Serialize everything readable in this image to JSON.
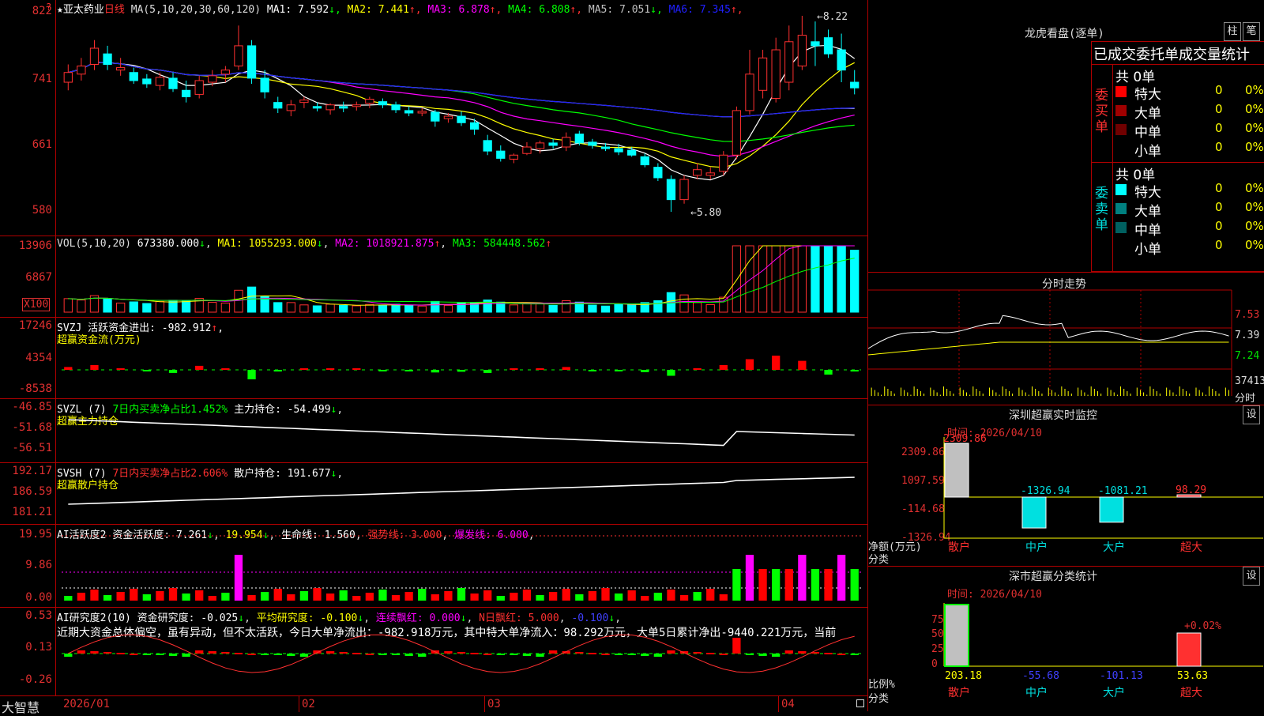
{
  "main": {
    "stock_name": "亚太药业",
    "period": "日线",
    "ma_params": "MA(5,10,20,30,60,120)",
    "ma": [
      {
        "label": "MA1: 7.592",
        "arrow": "↓",
        "color": "#ffffff"
      },
      {
        "label": "MA2: 7.441",
        "arrow": "↑",
        "color": "#ffff00"
      },
      {
        "label": "MA3: 6.878",
        "arrow": "↑",
        "color": "#ff00ff"
      },
      {
        "label": "MA4: 6.808",
        "arrow": "↑",
        "color": "#00ff00"
      },
      {
        "label": "MA5: 7.051",
        "arrow": "↓",
        "color": "#c0c0c0"
      },
      {
        "label": "MA6: 7.345",
        "arrow": "↑",
        "color": "#2020ff"
      }
    ],
    "y_ticks": [
      "822",
      "741",
      "661",
      "580"
    ],
    "high_mark": "8.22",
    "low_mark": "5.80"
  },
  "vol": {
    "header": "VOL(5,10,20)",
    "value": "673380.000",
    "ma1": "MA1: 1055293.000",
    "ma2": "MA2: 1018921.875",
    "ma3": "MA3: 584448.562",
    "y_ticks": [
      "13906",
      "6867"
    ],
    "unit": "X100"
  },
  "svzj": {
    "name": "SVZJ",
    "label": "活跃资金进出: -982.912",
    "subtitle": "超赢资金流(万元)",
    "y_ticks": [
      "17246",
      "4354",
      "-8538"
    ]
  },
  "svzl": {
    "name": "SVZL  (7)",
    "text1": "7日内买卖净占比1.452%",
    "text2": "主力持仓: -54.499",
    "subtitle": "超赢主力持仓",
    "y_ticks": [
      "-46.85",
      "-51.68",
      "-56.51"
    ]
  },
  "svsh": {
    "name": "SVSH  (7)",
    "text1": "7日内买卖净占比2.606%",
    "text2": "散户持仓: 191.677",
    "subtitle": "超赢散户持仓",
    "y_ticks": [
      "192.17",
      "186.59",
      "181.21"
    ]
  },
  "ai1": {
    "name": "AI活跃度2",
    "t1": "资金活跃度: 7.261",
    "t2": "19.954",
    "t3": "生命线: 1.560",
    "t4": "强势线: 3.000",
    "t5": "爆发线: 6.000",
    "y_ticks": [
      "19.95",
      "9.86",
      "0.00"
    ]
  },
  "ai2": {
    "name": "AI研究度2(10)",
    "t1": "资金研究度: -0.025",
    "t2": "平均研究度: -0.100",
    "t3": "连续飘红: 0.000",
    "t4": "N日飘红: 5.000",
    "t5": "-0.100",
    "comment": "近期大资金总体偏空，虽有异动，但不太活跃，今日大单净流出：-982.918万元，其中特大单净流入：98.292万元，大单5日累计净出-9440.221万元，当前",
    "y_ticks": [
      "0.53",
      "0.13",
      "-0.26"
    ]
  },
  "bottom": {
    "brand": "大智慧",
    "dates": [
      "2026/01",
      "02",
      "03",
      "04"
    ]
  },
  "right": {
    "title": "龙虎看盘(逐单)",
    "tabs": [
      "柱",
      "笔"
    ],
    "header": "已成交委托单成交量统计",
    "buy_label": "委买单",
    "sell_label": "委卖单",
    "buy_total": "共 0单",
    "sell_total": "共 0单",
    "buy_rows": [
      {
        "name": "特大",
        "count": "0",
        "pct": "0%",
        "color": "#ff0000"
      },
      {
        "name": "大单",
        "count": "0",
        "pct": "0%",
        "color": "#a00000"
      },
      {
        "name": "中单",
        "count": "0",
        "pct": "0%",
        "color": "#700000"
      },
      {
        "name": "小单",
        "count": "0",
        "pct": "0%",
        "color": ""
      }
    ],
    "sell_rows": [
      {
        "name": "特大",
        "count": "0",
        "pct": "0%",
        "color": "#00ffff"
      },
      {
        "name": "大单",
        "count": "0",
        "pct": "0%",
        "color": "#008080"
      },
      {
        "name": "中单",
        "count": "0",
        "pct": "0%",
        "color": "#006060"
      },
      {
        "name": "小单",
        "count": "0",
        "pct": "0%",
        "color": ""
      }
    ],
    "intraday_title": "分时走势",
    "intraday_ticks": [
      "7.53",
      "7.39",
      "7.24"
    ],
    "intraday_vol": "37413",
    "intraday_label": "分时",
    "monitor_title": "深圳超赢实时监控",
    "monitor_settings": "设",
    "monitor_time": "时间: 2026/04/10",
    "monitor_y": [
      "2309.86",
      "1097.59",
      "-114.68",
      "-1326.94"
    ],
    "monitor_values": [
      "2309.86",
      "-1326.94",
      "-1081.21",
      "98.29"
    ],
    "monitor_axis_label": "净额(万元)",
    "monitor_axis_label2": "分类",
    "categories": [
      "散户",
      "中户",
      "大户",
      "超大"
    ],
    "stats_title": "深市超赢分类统计",
    "stats_settings": "设",
    "stats_time": "时间: 2026/04/10",
    "stats_y": [
      "75",
      "50",
      "25",
      "0"
    ],
    "stats_values": [
      "203.18",
      "-55.68",
      "-101.13",
      "53.63"
    ],
    "stats_pct": "+0.02%",
    "stats_axis_label": "比例%",
    "stats_axis_label2": "分类"
  },
  "chart_data": {
    "type": "candlestick",
    "x_labels": [
      "2026/01",
      "02",
      "03",
      "04"
    ],
    "ylim": [
      5.8,
      8.22
    ],
    "ohlc": [
      {
        "o": 7.4,
        "h": 7.62,
        "l": 7.3,
        "c": 7.52
      },
      {
        "o": 7.5,
        "h": 7.7,
        "l": 7.42,
        "c": 7.6
      },
      {
        "o": 7.62,
        "h": 7.92,
        "l": 7.55,
        "c": 7.82
      },
      {
        "o": 7.75,
        "h": 7.85,
        "l": 7.55,
        "c": 7.62
      },
      {
        "o": 7.55,
        "h": 7.7,
        "l": 7.48,
        "c": 7.58
      },
      {
        "o": 7.52,
        "h": 7.58,
        "l": 7.38,
        "c": 7.42
      },
      {
        "o": 7.44,
        "h": 7.5,
        "l": 7.33,
        "c": 7.38
      },
      {
        "o": 7.36,
        "h": 7.52,
        "l": 7.3,
        "c": 7.46
      },
      {
        "o": 7.45,
        "h": 7.52,
        "l": 7.28,
        "c": 7.32
      },
      {
        "o": 7.3,
        "h": 7.42,
        "l": 7.15,
        "c": 7.22
      },
      {
        "o": 7.25,
        "h": 7.48,
        "l": 7.2,
        "c": 7.42
      },
      {
        "o": 7.4,
        "h": 7.55,
        "l": 7.35,
        "c": 7.48
      },
      {
        "o": 7.5,
        "h": 7.6,
        "l": 7.4,
        "c": 7.55
      },
      {
        "o": 7.6,
        "h": 8.1,
        "l": 7.55,
        "c": 7.85
      },
      {
        "o": 7.85,
        "h": 7.92,
        "l": 7.38,
        "c": 7.45
      },
      {
        "o": 7.45,
        "h": 7.55,
        "l": 7.2,
        "c": 7.28
      },
      {
        "o": 7.15,
        "h": 7.22,
        "l": 7.02,
        "c": 7.08
      },
      {
        "o": 7.05,
        "h": 7.18,
        "l": 6.98,
        "c": 7.12
      },
      {
        "o": 7.15,
        "h": 7.22,
        "l": 7.08,
        "c": 7.18
      },
      {
        "o": 7.1,
        "h": 7.15,
        "l": 7.04,
        "c": 7.08
      },
      {
        "o": 7.06,
        "h": 7.14,
        "l": 7.0,
        "c": 7.12
      },
      {
        "o": 7.1,
        "h": 7.16,
        "l": 7.03,
        "c": 7.08
      },
      {
        "o": 7.1,
        "h": 7.16,
        "l": 7.05,
        "c": 7.12
      },
      {
        "o": 7.14,
        "h": 7.22,
        "l": 7.08,
        "c": 7.19
      },
      {
        "o": 7.16,
        "h": 7.2,
        "l": 7.08,
        "c": 7.12
      },
      {
        "o": 7.12,
        "h": 7.16,
        "l": 7.02,
        "c": 7.06
      },
      {
        "o": 7.05,
        "h": 7.1,
        "l": 6.98,
        "c": 7.02
      },
      {
        "o": 7.02,
        "h": 7.08,
        "l": 6.98,
        "c": 7.04
      },
      {
        "o": 7.03,
        "h": 7.06,
        "l": 6.85,
        "c": 6.92
      },
      {
        "o": 6.95,
        "h": 7.02,
        "l": 6.9,
        "c": 6.98
      },
      {
        "o": 6.98,
        "h": 7.04,
        "l": 6.86,
        "c": 6.9
      },
      {
        "o": 6.9,
        "h": 6.95,
        "l": 6.75,
        "c": 6.82
      },
      {
        "o": 6.68,
        "h": 6.75,
        "l": 6.5,
        "c": 6.55
      },
      {
        "o": 6.55,
        "h": 6.62,
        "l": 6.42,
        "c": 6.46
      },
      {
        "o": 6.45,
        "h": 6.52,
        "l": 6.4,
        "c": 6.5
      },
      {
        "o": 6.52,
        "h": 6.66,
        "l": 6.5,
        "c": 6.6
      },
      {
        "o": 6.58,
        "h": 6.68,
        "l": 6.52,
        "c": 6.65
      },
      {
        "o": 6.65,
        "h": 6.7,
        "l": 6.58,
        "c": 6.62
      },
      {
        "o": 6.6,
        "h": 6.78,
        "l": 6.55,
        "c": 6.72
      },
      {
        "o": 6.76,
        "h": 6.8,
        "l": 6.62,
        "c": 6.65
      },
      {
        "o": 6.66,
        "h": 6.7,
        "l": 6.58,
        "c": 6.62
      },
      {
        "o": 6.6,
        "h": 6.65,
        "l": 6.55,
        "c": 6.58
      },
      {
        "o": 6.58,
        "h": 6.64,
        "l": 6.5,
        "c": 6.54
      },
      {
        "o": 6.56,
        "h": 6.6,
        "l": 6.48,
        "c": 6.5
      },
      {
        "o": 6.48,
        "h": 6.52,
        "l": 6.35,
        "c": 6.38
      },
      {
        "o": 6.35,
        "h": 6.4,
        "l": 6.18,
        "c": 6.22
      },
      {
        "o": 6.2,
        "h": 6.25,
        "l": 5.8,
        "c": 5.95
      },
      {
        "o": 5.95,
        "h": 6.25,
        "l": 5.9,
        "c": 6.2
      },
      {
        "o": 6.25,
        "h": 6.4,
        "l": 6.2,
        "c": 6.32
      },
      {
        "o": 6.25,
        "h": 6.35,
        "l": 6.2,
        "c": 6.28
      },
      {
        "o": 6.3,
        "h": 6.55,
        "l": 6.25,
        "c": 6.5
      },
      {
        "o": 6.5,
        "h": 7.1,
        "l": 6.45,
        "c": 7.05
      },
      {
        "o": 7.05,
        "h": 7.8,
        "l": 7.0,
        "c": 7.5
      },
      {
        "o": 7.3,
        "h": 7.8,
        "l": 7.2,
        "c": 7.7
      },
      {
        "o": 7.2,
        "h": 7.95,
        "l": 7.15,
        "c": 7.8
      },
      {
        "o": 7.4,
        "h": 8.1,
        "l": 7.3,
        "c": 7.9
      },
      {
        "o": 7.6,
        "h": 8.22,
        "l": 7.55,
        "c": 7.98
      },
      {
        "o": 7.9,
        "h": 8.15,
        "l": 7.6,
        "c": 7.85
      },
      {
        "o": 7.95,
        "h": 8.05,
        "l": 7.7,
        "c": 7.75
      },
      {
        "o": 7.8,
        "h": 8.0,
        "l": 7.4,
        "c": 7.55
      },
      {
        "o": 7.4,
        "h": 7.55,
        "l": 7.25,
        "c": 7.33
      }
    ]
  }
}
